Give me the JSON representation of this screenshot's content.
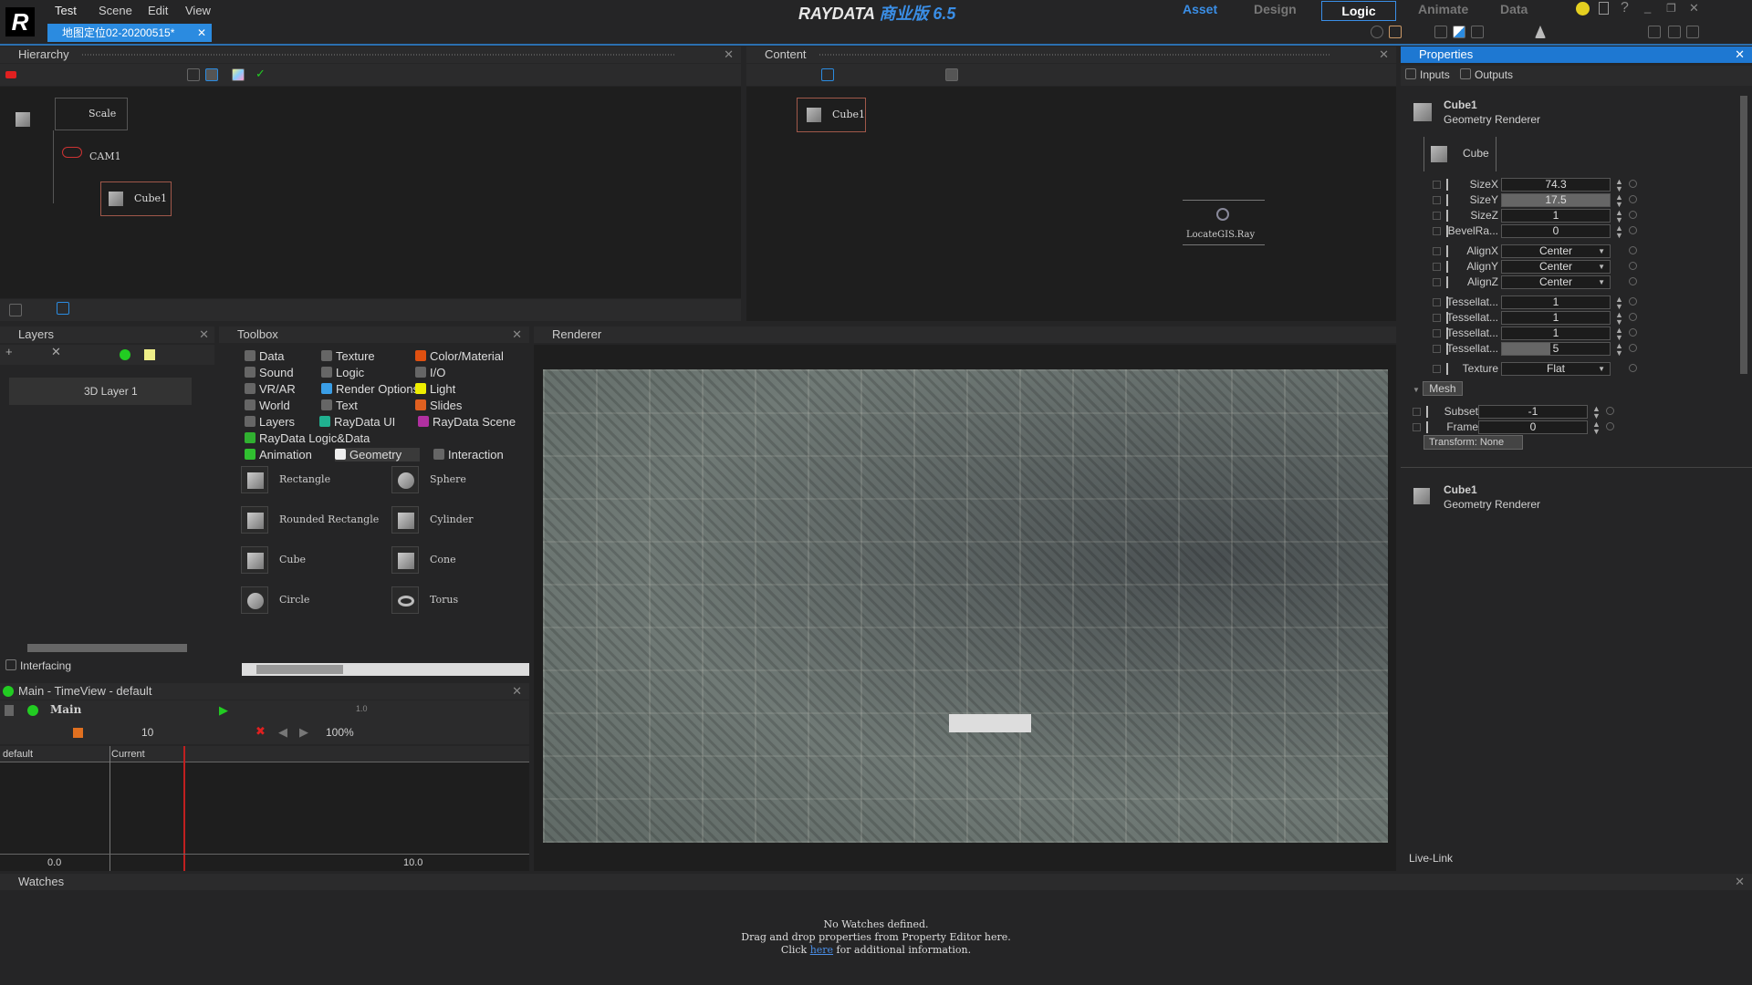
{
  "app": {
    "logo": "R",
    "brand": "RAYDATA",
    "edition": "商业版 6.5",
    "menu": [
      "Test",
      "Scene",
      "Edit",
      "View"
    ],
    "doc_tab": "地图定位02-20200515*"
  },
  "modes": {
    "items": [
      "Asset",
      "Design",
      "Logic",
      "Animate",
      "Data"
    ],
    "active": "Logic"
  },
  "hierarchy": {
    "title": "Hierarchy",
    "nodes": [
      "Scale",
      "CAM1",
      "Cube1"
    ]
  },
  "content": {
    "title": "Content",
    "nodes": [
      "Cube1",
      "LocateGIS.Ray"
    ]
  },
  "layers": {
    "title": "Layers",
    "items": [
      "3D Layer 1"
    ]
  },
  "interfacing": "Interfacing",
  "toolbox": {
    "title": "Toolbox",
    "categories": [
      [
        "Data",
        "Texture",
        "Color/Material"
      ],
      [
        "Sound",
        "Logic",
        "I/O"
      ],
      [
        "VR/AR",
        "Render Options",
        "Light"
      ],
      [
        "World",
        "Text",
        "Slides"
      ],
      [
        "Layers",
        "RayData UI",
        "RayData Scene"
      ],
      [
        "RayData Logic&Data"
      ],
      [
        "Animation",
        "Geometry",
        "Interaction"
      ]
    ],
    "active": "Geometry",
    "geometry": [
      "Rectangle",
      "Sphere",
      "Rounded Rectangle",
      "Cylinder",
      "Cube",
      "Cone",
      "Circle",
      "Torus"
    ]
  },
  "renderer": {
    "title": "Renderer"
  },
  "timeview": {
    "title": "Main - TimeView - default",
    "timeline": "Main",
    "frame_rate": "10",
    "zoom": "100%",
    "speed": "1.0",
    "col_default": "default",
    "col_current": "Current",
    "start": "0.0",
    "mark": "10.0"
  },
  "watches": {
    "title": "Watches",
    "line1": "No Watches defined.",
    "line2": "Drag and drop properties from Property Editor here.",
    "line3_pre": "Click ",
    "link": "here",
    "line3_post": " for additional information."
  },
  "properties": {
    "title": "Properties",
    "tab_inputs": "Inputs",
    "tab_outputs": "Outputs",
    "object": "Cube1",
    "type": "Geometry Renderer",
    "geom": "Cube",
    "fields": [
      {
        "label": "SizeX",
        "value": "74.3"
      },
      {
        "label": "SizeY",
        "value": "17.5"
      },
      {
        "label": "SizeZ",
        "value": "1"
      },
      {
        "label": "BevelRa...",
        "value": "0"
      },
      {
        "label": "AlignX",
        "value": "Center"
      },
      {
        "label": "AlignY",
        "value": "Center"
      },
      {
        "label": "AlignZ",
        "value": "Center"
      },
      {
        "label": "Tessellat...",
        "value": "1"
      },
      {
        "label": "Tessellat...",
        "value": "1"
      },
      {
        "label": "Tessellat...",
        "value": "1"
      },
      {
        "label": "Tessellat...",
        "value": "5"
      },
      {
        "label": "Texture",
        "value": "Flat"
      }
    ],
    "mesh_label": "Mesh",
    "mesh": [
      {
        "label": "Subset",
        "value": "-1"
      },
      {
        "label": "Frame",
        "value": "0"
      }
    ],
    "transform": "Transform:  None",
    "object2": "Cube1",
    "type2": "Geometry Renderer",
    "livelink": "Live-Link"
  },
  "colors": {
    "accent": "#2b8be0",
    "panel": "#1e1e1e",
    "title_blue": "#1e78d2"
  }
}
